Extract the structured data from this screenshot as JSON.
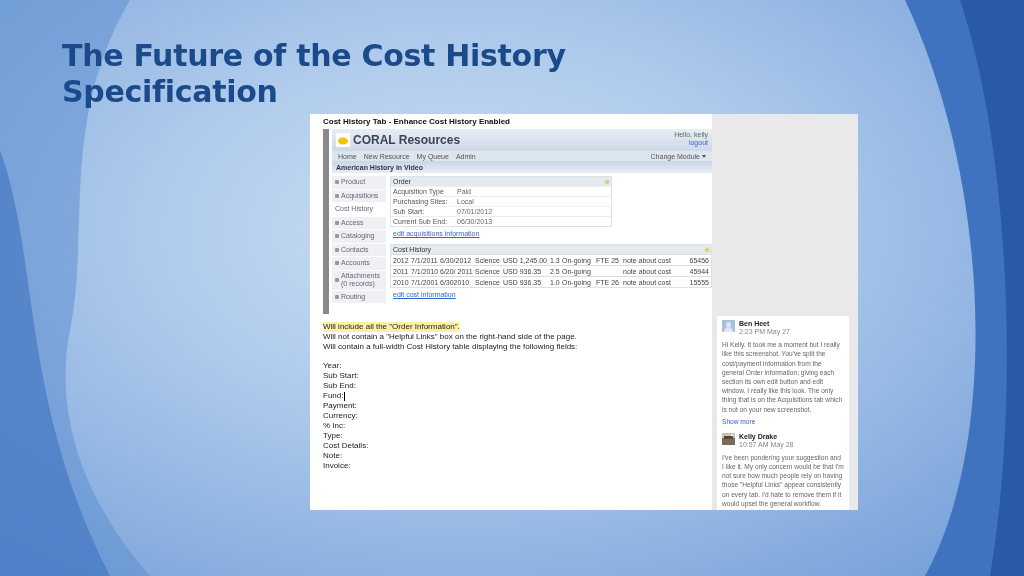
{
  "slide": {
    "title": "The Future of the Cost History Specification"
  },
  "document": {
    "heading": "Cost History Tab - Enhance Cost History Enabled",
    "app": {
      "logo": "CORAL Resources",
      "user": "Hello, kelly",
      "logout": "logout",
      "nav": [
        "Home",
        "New Resource",
        "My Queue",
        "Admin"
      ],
      "module_menu": "Change Module",
      "resource_title": "American History in Video",
      "sidebar": [
        {
          "label": "Product",
          "selected": false
        },
        {
          "label": "Acquisitions",
          "selected": false
        },
        {
          "label": "Cost History",
          "selected": true
        },
        {
          "label": "Access",
          "selected": false
        },
        {
          "label": "Cataloging",
          "selected": false
        },
        {
          "label": "Contacts",
          "selected": false
        },
        {
          "label": "Accounts",
          "selected": false
        },
        {
          "label": "Attachments",
          "sub": "(0 records)",
          "selected": false
        },
        {
          "label": "Routing",
          "selected": false
        }
      ],
      "order": {
        "title": "Order",
        "rows": [
          {
            "label": "Acquisition Type",
            "value": "Paid"
          },
          {
            "label": "Purchasing Sites:",
            "value": "Local"
          },
          {
            "label": "Sub Start:",
            "value": "07/01/2012"
          },
          {
            "label": "Current Sub End:",
            "value": "06/30/2013"
          }
        ],
        "edit_link": "edit acquisitions information"
      },
      "cost_history": {
        "title": "Cost History",
        "rows": [
          {
            "year": "2012",
            "start": "7/1/2011",
            "end": "6/30/2012",
            "fund": "Science",
            "payment": "USD 1,245.00",
            "inc": "1.3",
            "type": "On-going",
            "details": "FTE 25",
            "note": "note about cost",
            "invoice": "65456"
          },
          {
            "year": "2011",
            "start": "7/1/2010",
            "end": "6/20/ 2011",
            "fund": "Science",
            "payment": "USD  936.35",
            "inc": "2.5",
            "type": "On-going",
            "note": "note about cost",
            "invoice": "45944"
          },
          {
            "year": "2010",
            "start": "7/1/2001",
            "end": "6/302010",
            "fund": "Science",
            "payment": "USD  936.35",
            "inc": "1.0",
            "type": "On-going",
            "details": "FTE 26",
            "note": "note about cost",
            "invoice": "15555"
          }
        ],
        "edit_link": "edit cost information"
      }
    },
    "paragraphs": [
      {
        "text": "Will include all the \"Order Information\".",
        "highlighted": true
      },
      {
        "text": "Will not contain a \"Helpful Links\" box on the right-hand side of the page.",
        "highlighted": false
      },
      {
        "text": "Will contain a full-width Cost History table displaying the following fields:",
        "highlighted": false
      }
    ],
    "fields": [
      {
        "text": "Year:"
      },
      {
        "text": "Sub Start:"
      },
      {
        "text": "Sub End:"
      },
      {
        "text": "Fund:",
        "cursor": true
      },
      {
        "text": "Payment:"
      },
      {
        "text": "Currency:"
      },
      {
        "text": "% Inc:"
      },
      {
        "text": "Type:"
      },
      {
        "text": "Cost Details:"
      },
      {
        "text": "Note:"
      },
      {
        "text": "Invoice:"
      }
    ]
  },
  "comments": [
    {
      "author": "Ben Heet",
      "time": "2:23 PM May 27",
      "kind": "silhouette",
      "text": "Hi Kelly. It took me a moment but I really like this screenshot. You've split the cost/payment information from the general Order information; giving each section its own edit button and edit window. I really like this look. The only thing that is on the Acquisitions tab which is not on your new screenshot.",
      "show_more": "Show more"
    },
    {
      "author": "Kelly Drake",
      "time": "10:57 AM May 28",
      "kind": "picture",
      "text": "I've been pondering your suggestion and I like it. My only concern would be that I'm not sure how much people rely on having those \"Helpful Links\" appear consistently on every tab. I'd hate to remove them if it would upset the general workflow."
    }
  ]
}
